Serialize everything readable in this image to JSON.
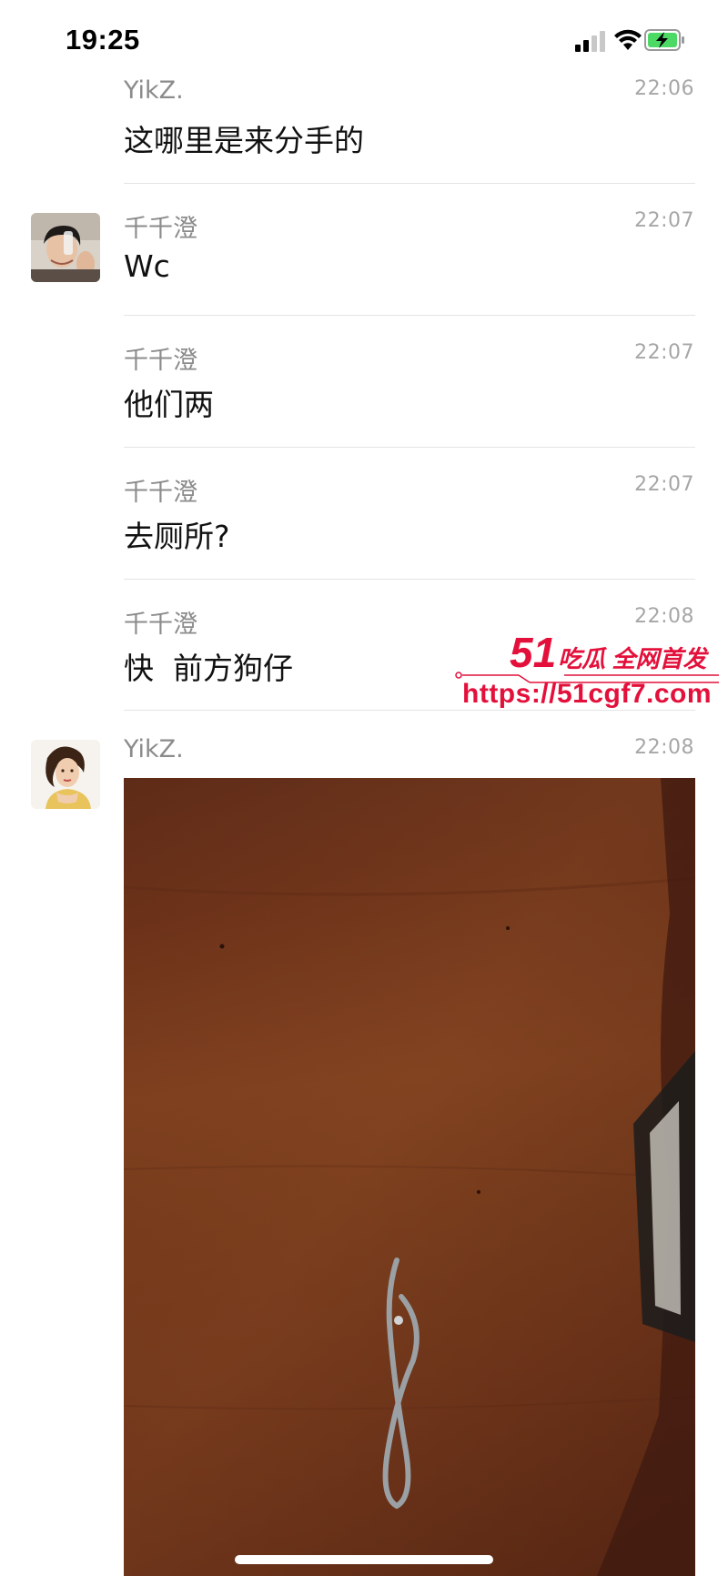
{
  "status_bar": {
    "time": "19:25"
  },
  "messages": [
    {
      "sender": "YikZ.",
      "time": "22:06",
      "text": "这哪里是来分手的"
    },
    {
      "sender": "千千澄",
      "time": "22:07",
      "text": "Wc"
    },
    {
      "sender": "千千澄",
      "time": "22:07",
      "text": "他们两"
    },
    {
      "sender": "千千澄",
      "time": "22:07",
      "text": "去厕所?"
    },
    {
      "sender": "千千澄",
      "time": "22:08",
      "text": "快  前方狗仔"
    },
    {
      "sender": "YikZ.",
      "time": "22:08"
    }
  ],
  "watermark": {
    "brand_number": "51",
    "brand_text": "吃瓜 全网首发",
    "url": "https://51cgf7.com"
  },
  "icons": {
    "signal": "cellular-signal-icon",
    "wifi": "wifi-icon",
    "battery": "battery-charging-icon"
  },
  "colors": {
    "battery_green": "#4cd964",
    "watermark_red": "#e3103b",
    "sender_gray": "#8b8b8b"
  }
}
